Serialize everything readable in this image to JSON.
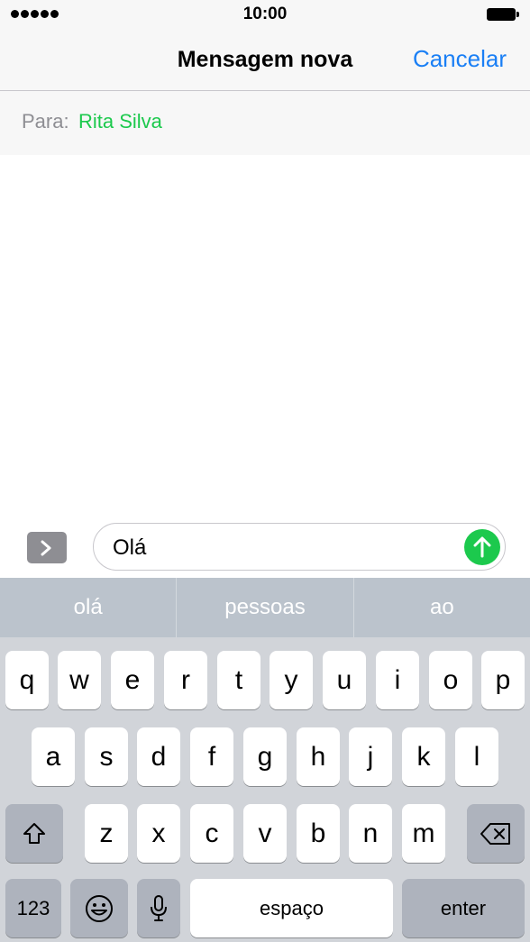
{
  "status": {
    "time": "10:00"
  },
  "navbar": {
    "title": "Mensagem nova",
    "cancel_label": "Cancelar"
  },
  "to_field": {
    "label": "Para:",
    "recipient": "Rita Silva"
  },
  "composer": {
    "message_text": "Olá"
  },
  "suggestions": [
    "olá",
    "pessoas",
    "ao"
  ],
  "keyboard": {
    "row1": [
      "q",
      "w",
      "e",
      "r",
      "t",
      "y",
      "u",
      "i",
      "o",
      "p"
    ],
    "row2": [
      "a",
      "s",
      "d",
      "f",
      "g",
      "h",
      "j",
      "k",
      "l"
    ],
    "row3": [
      "z",
      "x",
      "c",
      "v",
      "b",
      "n",
      "m"
    ],
    "numbers_label": "123",
    "space_label": "espaço",
    "enter_label": "enter"
  },
  "colors": {
    "accent": "#1a7ff5",
    "green": "#1cc94d"
  }
}
